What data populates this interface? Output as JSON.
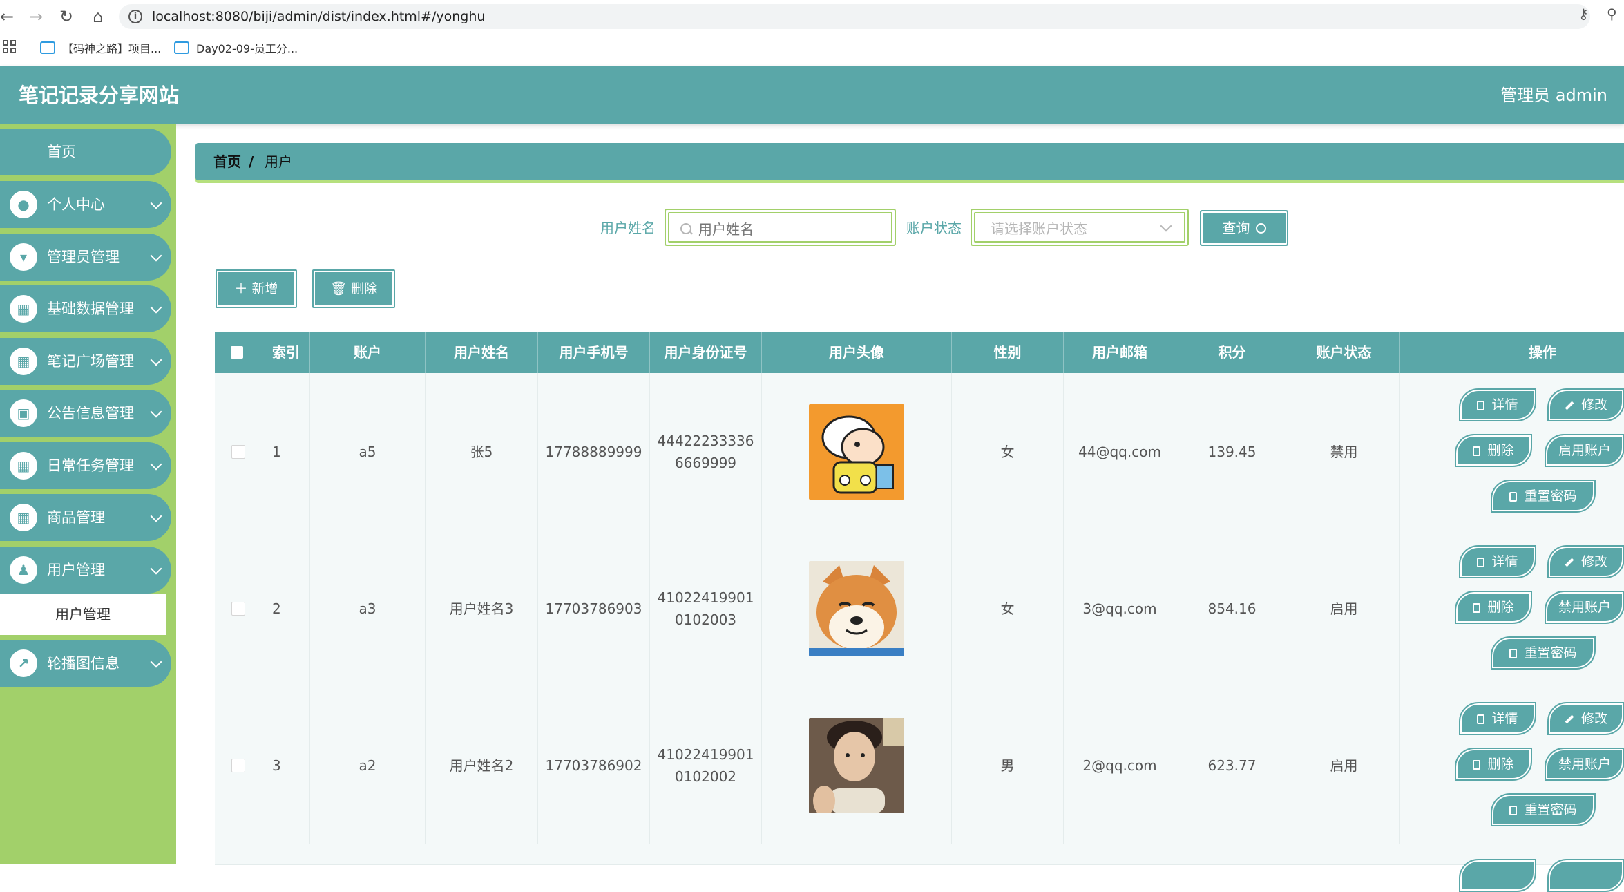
{
  "browser": {
    "url": "localhost:8080/biji/admin/dist/index.html#/yonghu",
    "bookmarks": [
      "【码神之路】项目...",
      "Day02-09-员工分..."
    ]
  },
  "header": {
    "title": "笔记记录分享网站",
    "admin": "管理员 admin"
  },
  "sidebar": {
    "home": "首页",
    "items": [
      {
        "label": "个人中心",
        "icon": "person-icon"
      },
      {
        "label": "管理员管理",
        "icon": "admin-icon"
      },
      {
        "label": "基础数据管理",
        "icon": "grid-icon"
      },
      {
        "label": "笔记广场管理",
        "icon": "grid-icon"
      },
      {
        "label": "公告信息管理",
        "icon": "wallet-icon"
      },
      {
        "label": "日常任务管理",
        "icon": "grid-icon"
      },
      {
        "label": "商品管理",
        "icon": "grid-icon"
      },
      {
        "label": "用户管理",
        "icon": "user-icon"
      },
      {
        "label": "轮播图信息",
        "icon": "chart-icon"
      }
    ],
    "submenu": "用户管理"
  },
  "breadcrumb": {
    "home": "首页",
    "sep": "/",
    "current": "用户"
  },
  "search": {
    "name_label": "用户姓名",
    "name_placeholder": "用户姓名",
    "status_label": "账户状态",
    "status_placeholder": "请选择账户状态",
    "query": "查询"
  },
  "toolbar": {
    "add": "新增",
    "delete": "删除"
  },
  "table": {
    "columns": [
      "索引",
      "账户",
      "用户姓名",
      "用户手机号",
      "用户身份证号",
      "用户头像",
      "性别",
      "用户邮箱",
      "积分",
      "账户状态",
      "操作"
    ],
    "rows": [
      {
        "index": "1",
        "account": "a5",
        "name": "张5",
        "phone": "17788889999",
        "idcard": "444222333366669999",
        "avatar": "cartoon-boy-avatar",
        "gender": "女",
        "email": "44@qq.com",
        "points": "139.45",
        "status": "禁用",
        "toggle": "启用账户"
      },
      {
        "index": "2",
        "account": "a3",
        "name": "用户姓名3",
        "phone": "17703786903",
        "idcard": "410224199010102003",
        "avatar": "shiba-dog-avatar",
        "gender": "女",
        "email": "3@qq.com",
        "points": "854.16",
        "status": "启用",
        "toggle": "禁用账户"
      },
      {
        "index": "3",
        "account": "a2",
        "name": "用户姓名2",
        "phone": "17703786902",
        "idcard": "410224199010102002",
        "avatar": "young-man-photo-avatar",
        "gender": "男",
        "email": "2@qq.com",
        "points": "623.77",
        "status": "启用",
        "toggle": "禁用账户"
      }
    ],
    "actions": {
      "detail": "详情",
      "edit": "修改",
      "delete": "删除",
      "reset": "重置密码"
    }
  },
  "colors": {
    "primary": "#5aa7a8",
    "sidebar": "#a2d06a",
    "accent_border": "#a2d06a"
  }
}
